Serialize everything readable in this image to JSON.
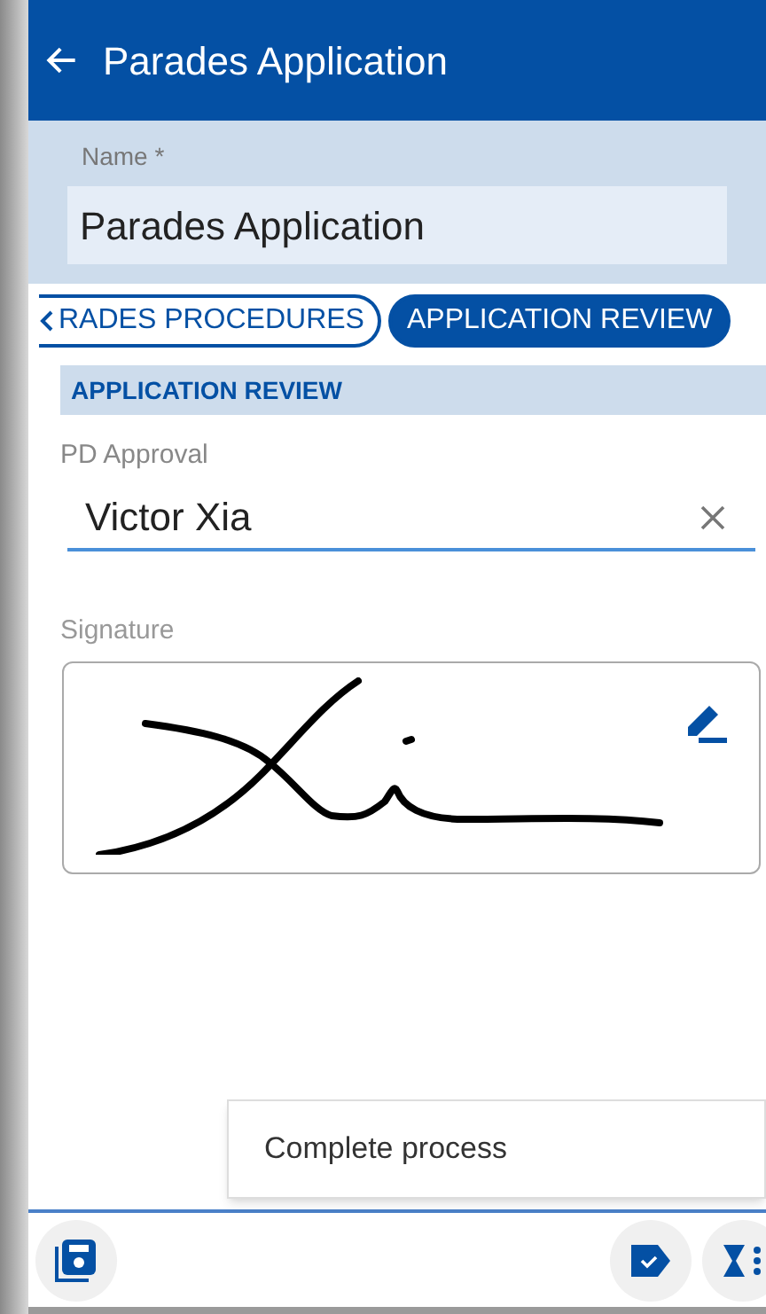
{
  "app_bar": {
    "title": "Parades Application"
  },
  "name_field": {
    "label": "Name *",
    "value": "Parades Application"
  },
  "stages": [
    {
      "label": "RADES PROCEDURES",
      "selected": false
    },
    {
      "label": "APPLICATION REVIEW",
      "selected": true
    }
  ],
  "section": {
    "title": "APPLICATION REVIEW"
  },
  "approval_field": {
    "label": "PD Approval",
    "value": "Victor Xia"
  },
  "signature": {
    "label": "Signature"
  },
  "popup_menu": {
    "items": [
      "Complete process"
    ]
  }
}
